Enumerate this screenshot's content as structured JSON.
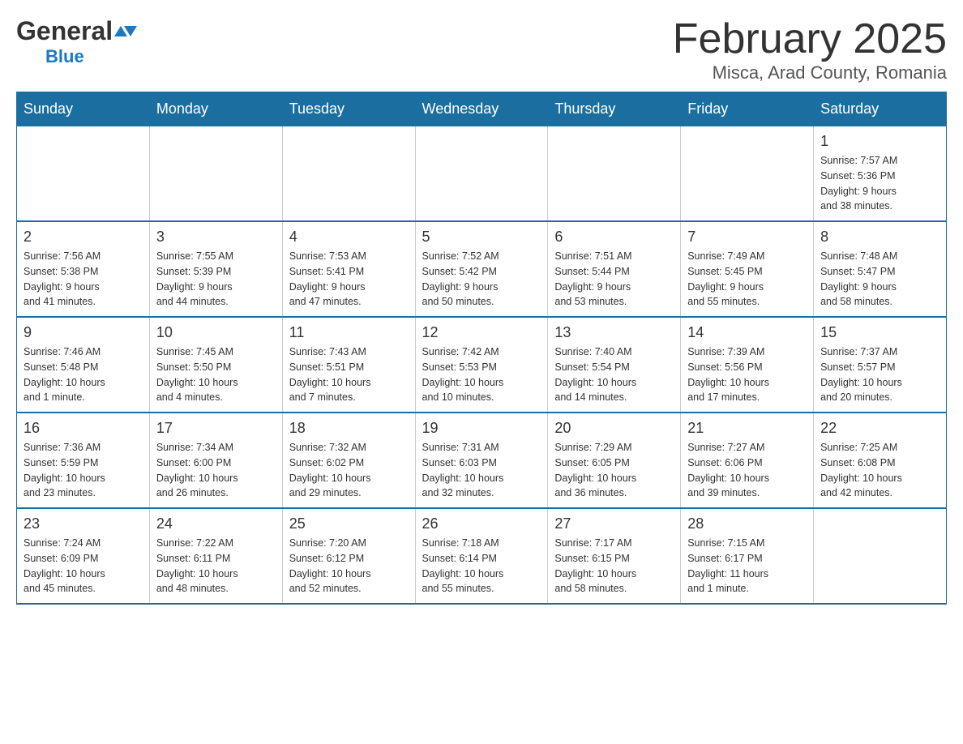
{
  "logo": {
    "general": "General",
    "blue": "Blue"
  },
  "header": {
    "month_year": "February 2025",
    "location": "Misca, Arad County, Romania"
  },
  "days_of_week": [
    "Sunday",
    "Monday",
    "Tuesday",
    "Wednesday",
    "Thursday",
    "Friday",
    "Saturday"
  ],
  "weeks": [
    {
      "cells": [
        {
          "day": "",
          "info": ""
        },
        {
          "day": "",
          "info": ""
        },
        {
          "day": "",
          "info": ""
        },
        {
          "day": "",
          "info": ""
        },
        {
          "day": "",
          "info": ""
        },
        {
          "day": "",
          "info": ""
        },
        {
          "day": "1",
          "info": "Sunrise: 7:57 AM\nSunset: 5:36 PM\nDaylight: 9 hours\nand 38 minutes."
        }
      ]
    },
    {
      "cells": [
        {
          "day": "2",
          "info": "Sunrise: 7:56 AM\nSunset: 5:38 PM\nDaylight: 9 hours\nand 41 minutes."
        },
        {
          "day": "3",
          "info": "Sunrise: 7:55 AM\nSunset: 5:39 PM\nDaylight: 9 hours\nand 44 minutes."
        },
        {
          "day": "4",
          "info": "Sunrise: 7:53 AM\nSunset: 5:41 PM\nDaylight: 9 hours\nand 47 minutes."
        },
        {
          "day": "5",
          "info": "Sunrise: 7:52 AM\nSunset: 5:42 PM\nDaylight: 9 hours\nand 50 minutes."
        },
        {
          "day": "6",
          "info": "Sunrise: 7:51 AM\nSunset: 5:44 PM\nDaylight: 9 hours\nand 53 minutes."
        },
        {
          "day": "7",
          "info": "Sunrise: 7:49 AM\nSunset: 5:45 PM\nDaylight: 9 hours\nand 55 minutes."
        },
        {
          "day": "8",
          "info": "Sunrise: 7:48 AM\nSunset: 5:47 PM\nDaylight: 9 hours\nand 58 minutes."
        }
      ]
    },
    {
      "cells": [
        {
          "day": "9",
          "info": "Sunrise: 7:46 AM\nSunset: 5:48 PM\nDaylight: 10 hours\nand 1 minute."
        },
        {
          "day": "10",
          "info": "Sunrise: 7:45 AM\nSunset: 5:50 PM\nDaylight: 10 hours\nand 4 minutes."
        },
        {
          "day": "11",
          "info": "Sunrise: 7:43 AM\nSunset: 5:51 PM\nDaylight: 10 hours\nand 7 minutes."
        },
        {
          "day": "12",
          "info": "Sunrise: 7:42 AM\nSunset: 5:53 PM\nDaylight: 10 hours\nand 10 minutes."
        },
        {
          "day": "13",
          "info": "Sunrise: 7:40 AM\nSunset: 5:54 PM\nDaylight: 10 hours\nand 14 minutes."
        },
        {
          "day": "14",
          "info": "Sunrise: 7:39 AM\nSunset: 5:56 PM\nDaylight: 10 hours\nand 17 minutes."
        },
        {
          "day": "15",
          "info": "Sunrise: 7:37 AM\nSunset: 5:57 PM\nDaylight: 10 hours\nand 20 minutes."
        }
      ]
    },
    {
      "cells": [
        {
          "day": "16",
          "info": "Sunrise: 7:36 AM\nSunset: 5:59 PM\nDaylight: 10 hours\nand 23 minutes."
        },
        {
          "day": "17",
          "info": "Sunrise: 7:34 AM\nSunset: 6:00 PM\nDaylight: 10 hours\nand 26 minutes."
        },
        {
          "day": "18",
          "info": "Sunrise: 7:32 AM\nSunset: 6:02 PM\nDaylight: 10 hours\nand 29 minutes."
        },
        {
          "day": "19",
          "info": "Sunrise: 7:31 AM\nSunset: 6:03 PM\nDaylight: 10 hours\nand 32 minutes."
        },
        {
          "day": "20",
          "info": "Sunrise: 7:29 AM\nSunset: 6:05 PM\nDaylight: 10 hours\nand 36 minutes."
        },
        {
          "day": "21",
          "info": "Sunrise: 7:27 AM\nSunset: 6:06 PM\nDaylight: 10 hours\nand 39 minutes."
        },
        {
          "day": "22",
          "info": "Sunrise: 7:25 AM\nSunset: 6:08 PM\nDaylight: 10 hours\nand 42 minutes."
        }
      ]
    },
    {
      "cells": [
        {
          "day": "23",
          "info": "Sunrise: 7:24 AM\nSunset: 6:09 PM\nDaylight: 10 hours\nand 45 minutes."
        },
        {
          "day": "24",
          "info": "Sunrise: 7:22 AM\nSunset: 6:11 PM\nDaylight: 10 hours\nand 48 minutes."
        },
        {
          "day": "25",
          "info": "Sunrise: 7:20 AM\nSunset: 6:12 PM\nDaylight: 10 hours\nand 52 minutes."
        },
        {
          "day": "26",
          "info": "Sunrise: 7:18 AM\nSunset: 6:14 PM\nDaylight: 10 hours\nand 55 minutes."
        },
        {
          "day": "27",
          "info": "Sunrise: 7:17 AM\nSunset: 6:15 PM\nDaylight: 10 hours\nand 58 minutes."
        },
        {
          "day": "28",
          "info": "Sunrise: 7:15 AM\nSunset: 6:17 PM\nDaylight: 11 hours\nand 1 minute."
        },
        {
          "day": "",
          "info": ""
        }
      ]
    }
  ]
}
